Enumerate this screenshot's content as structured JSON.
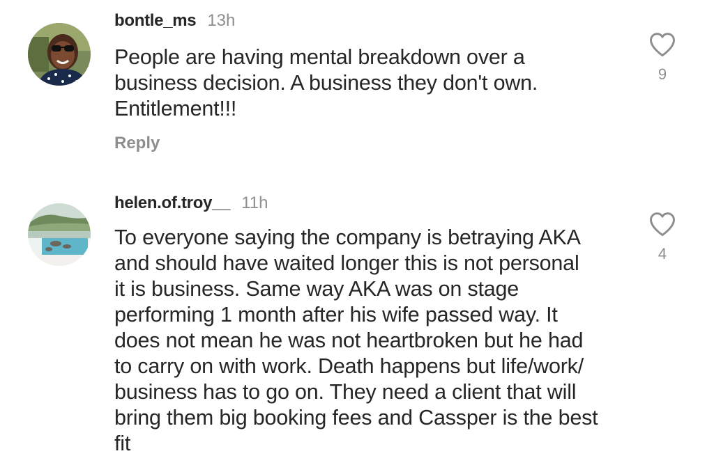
{
  "comments": [
    {
      "username": "bontle_ms",
      "time": "13h",
      "lines": [
        "People are having mental breakdown over a",
        "business decision. A business they don't own.",
        "Entitlement!!!"
      ],
      "reply_label": "Reply",
      "likes": "9",
      "like_icon": "heart-outline-icon"
    },
    {
      "username": "helen.of.troy__",
      "time": "11h",
      "lines": [
        "To everyone saying the company is betraying AKA",
        "and should have waited longer this is not personal",
        "it is business. Same way AKA was on stage",
        "performing 1 month after his wife passed way. It",
        "does not mean he was not heartbroken but he had",
        "to carry on with work. Death happens but life/work/",
        "business has to go on. They need a client that will",
        "bring them big booking fees and Cassper is the best",
        "fit"
      ],
      "likes": "4",
      "like_icon": "heart-outline-icon"
    }
  ],
  "colors": {
    "text": "#262626",
    "secondary": "#8e8e8e",
    "background": "#ffffff"
  }
}
